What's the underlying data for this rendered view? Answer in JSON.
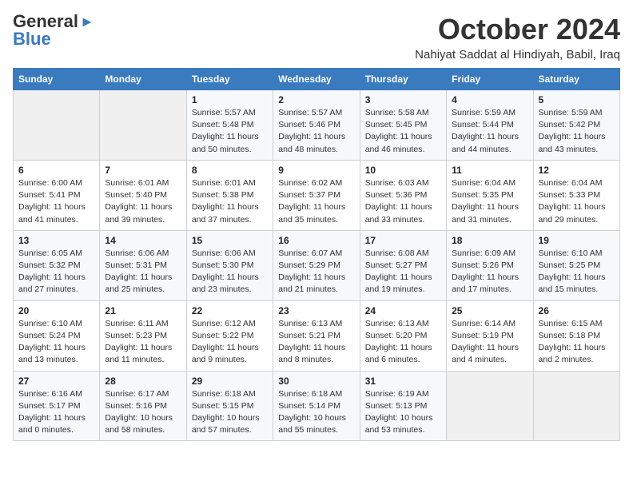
{
  "logo": {
    "general": "General",
    "blue": "Blue"
  },
  "title": "October 2024",
  "location": "Nahiyat Saddat al Hindiyah, Babil, Iraq",
  "days_of_week": [
    "Sunday",
    "Monday",
    "Tuesday",
    "Wednesday",
    "Thursday",
    "Friday",
    "Saturday"
  ],
  "weeks": [
    [
      {
        "day": "",
        "details": ""
      },
      {
        "day": "",
        "details": ""
      },
      {
        "day": "1",
        "details": "Sunrise: 5:57 AM\nSunset: 5:48 PM\nDaylight: 11 hours and 50 minutes."
      },
      {
        "day": "2",
        "details": "Sunrise: 5:57 AM\nSunset: 5:46 PM\nDaylight: 11 hours and 48 minutes."
      },
      {
        "day": "3",
        "details": "Sunrise: 5:58 AM\nSunset: 5:45 PM\nDaylight: 11 hours and 46 minutes."
      },
      {
        "day": "4",
        "details": "Sunrise: 5:59 AM\nSunset: 5:44 PM\nDaylight: 11 hours and 44 minutes."
      },
      {
        "day": "5",
        "details": "Sunrise: 5:59 AM\nSunset: 5:42 PM\nDaylight: 11 hours and 43 minutes."
      }
    ],
    [
      {
        "day": "6",
        "details": "Sunrise: 6:00 AM\nSunset: 5:41 PM\nDaylight: 11 hours and 41 minutes."
      },
      {
        "day": "7",
        "details": "Sunrise: 6:01 AM\nSunset: 5:40 PM\nDaylight: 11 hours and 39 minutes."
      },
      {
        "day": "8",
        "details": "Sunrise: 6:01 AM\nSunset: 5:38 PM\nDaylight: 11 hours and 37 minutes."
      },
      {
        "day": "9",
        "details": "Sunrise: 6:02 AM\nSunset: 5:37 PM\nDaylight: 11 hours and 35 minutes."
      },
      {
        "day": "10",
        "details": "Sunrise: 6:03 AM\nSunset: 5:36 PM\nDaylight: 11 hours and 33 minutes."
      },
      {
        "day": "11",
        "details": "Sunrise: 6:04 AM\nSunset: 5:35 PM\nDaylight: 11 hours and 31 minutes."
      },
      {
        "day": "12",
        "details": "Sunrise: 6:04 AM\nSunset: 5:33 PM\nDaylight: 11 hours and 29 minutes."
      }
    ],
    [
      {
        "day": "13",
        "details": "Sunrise: 6:05 AM\nSunset: 5:32 PM\nDaylight: 11 hours and 27 minutes."
      },
      {
        "day": "14",
        "details": "Sunrise: 6:06 AM\nSunset: 5:31 PM\nDaylight: 11 hours and 25 minutes."
      },
      {
        "day": "15",
        "details": "Sunrise: 6:06 AM\nSunset: 5:30 PM\nDaylight: 11 hours and 23 minutes."
      },
      {
        "day": "16",
        "details": "Sunrise: 6:07 AM\nSunset: 5:29 PM\nDaylight: 11 hours and 21 minutes."
      },
      {
        "day": "17",
        "details": "Sunrise: 6:08 AM\nSunset: 5:27 PM\nDaylight: 11 hours and 19 minutes."
      },
      {
        "day": "18",
        "details": "Sunrise: 6:09 AM\nSunset: 5:26 PM\nDaylight: 11 hours and 17 minutes."
      },
      {
        "day": "19",
        "details": "Sunrise: 6:10 AM\nSunset: 5:25 PM\nDaylight: 11 hours and 15 minutes."
      }
    ],
    [
      {
        "day": "20",
        "details": "Sunrise: 6:10 AM\nSunset: 5:24 PM\nDaylight: 11 hours and 13 minutes."
      },
      {
        "day": "21",
        "details": "Sunrise: 6:11 AM\nSunset: 5:23 PM\nDaylight: 11 hours and 11 minutes."
      },
      {
        "day": "22",
        "details": "Sunrise: 6:12 AM\nSunset: 5:22 PM\nDaylight: 11 hours and 9 minutes."
      },
      {
        "day": "23",
        "details": "Sunrise: 6:13 AM\nSunset: 5:21 PM\nDaylight: 11 hours and 8 minutes."
      },
      {
        "day": "24",
        "details": "Sunrise: 6:13 AM\nSunset: 5:20 PM\nDaylight: 11 hours and 6 minutes."
      },
      {
        "day": "25",
        "details": "Sunrise: 6:14 AM\nSunset: 5:19 PM\nDaylight: 11 hours and 4 minutes."
      },
      {
        "day": "26",
        "details": "Sunrise: 6:15 AM\nSunset: 5:18 PM\nDaylight: 11 hours and 2 minutes."
      }
    ],
    [
      {
        "day": "27",
        "details": "Sunrise: 6:16 AM\nSunset: 5:17 PM\nDaylight: 11 hours and 0 minutes."
      },
      {
        "day": "28",
        "details": "Sunrise: 6:17 AM\nSunset: 5:16 PM\nDaylight: 10 hours and 58 minutes."
      },
      {
        "day": "29",
        "details": "Sunrise: 6:18 AM\nSunset: 5:15 PM\nDaylight: 10 hours and 57 minutes."
      },
      {
        "day": "30",
        "details": "Sunrise: 6:18 AM\nSunset: 5:14 PM\nDaylight: 10 hours and 55 minutes."
      },
      {
        "day": "31",
        "details": "Sunrise: 6:19 AM\nSunset: 5:13 PM\nDaylight: 10 hours and 53 minutes."
      },
      {
        "day": "",
        "details": ""
      },
      {
        "day": "",
        "details": ""
      }
    ]
  ]
}
